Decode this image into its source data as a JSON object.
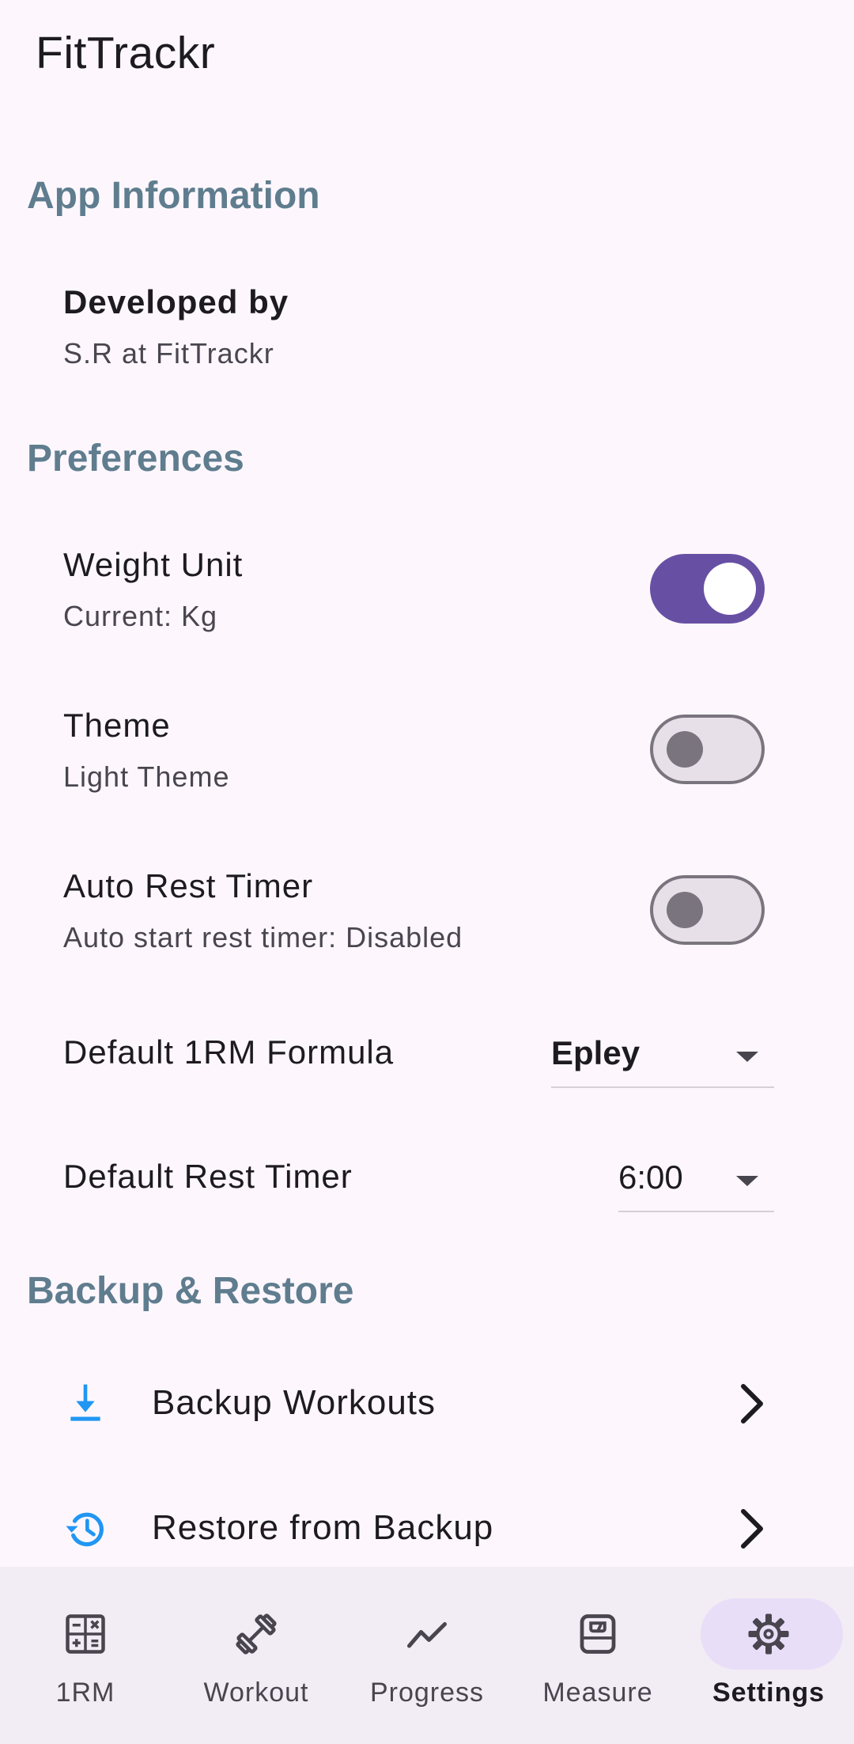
{
  "app": {
    "title": "FitTrackr"
  },
  "sections": {
    "app_info": "App Information",
    "preferences": "Preferences",
    "backup": "Backup & Restore"
  },
  "developed": {
    "title": "Developed by",
    "value": "S.R at FitTrackr"
  },
  "weight_unit": {
    "title": "Weight Unit",
    "subtitle": "Current: Kg",
    "enabled": true
  },
  "theme": {
    "title": "Theme",
    "subtitle": "Light Theme",
    "enabled": false
  },
  "auto_rest": {
    "title": "Auto Rest Timer",
    "subtitle": "Auto start rest timer: Disabled",
    "enabled": false
  },
  "formula": {
    "label": "Default 1RM Formula",
    "value": "Epley"
  },
  "rest_timer": {
    "label": "Default Rest Timer",
    "value": "6:00"
  },
  "actions": {
    "backup": {
      "label": "Backup Workouts",
      "icon": "download-icon"
    },
    "restore": {
      "label": "Restore from Backup",
      "icon": "history-icon"
    }
  },
  "nav": [
    {
      "label": "1RM",
      "icon": "calculator-icon",
      "active": false
    },
    {
      "label": "Workout",
      "icon": "dumbbell-icon",
      "active": false
    },
    {
      "label": "Progress",
      "icon": "trend-icon",
      "active": false
    },
    {
      "label": "Measure",
      "icon": "scale-icon",
      "active": false
    },
    {
      "label": "Settings",
      "icon": "gear-icon",
      "active": true
    }
  ],
  "colors": {
    "accent": "#6750a4",
    "section": "#5f7d8e",
    "background": "#fdf7fd",
    "nav_bg": "#f2ecf4",
    "nav_active_pill": "#e8def8",
    "action_icon": "#2196f3"
  }
}
